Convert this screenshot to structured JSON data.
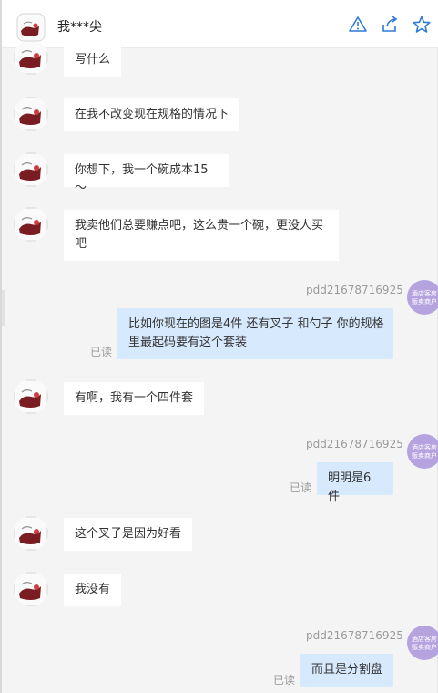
{
  "header": {
    "title": "我***尖",
    "icons": [
      "alert-icon",
      "share-icon",
      "star-icon"
    ],
    "accent_color": "#2f7bd6"
  },
  "messages": [
    {
      "side": "in",
      "text": "写什么"
    },
    {
      "side": "in",
      "text": "在我不改变现在规格的情况下"
    },
    {
      "side": "in",
      "text": "你想下，我一个碗成本15～"
    },
    {
      "side": "in",
      "text": "我卖他们总要赚点吧，这么贵一个碗，更没人买吧"
    },
    {
      "side": "out",
      "sender": "pdd21678716925",
      "text": "比如你现在的图是4件 还有叉子 和勺子 你的规格里最起码要有这个套装",
      "status": "已读"
    },
    {
      "side": "in",
      "text": "有啊，我有一个四件套"
    },
    {
      "side": "out",
      "sender": "pdd21678716925",
      "text": "明明是6件",
      "status": "已读"
    },
    {
      "side": "in",
      "text": "这个叉子是因为好看"
    },
    {
      "side": "in",
      "text": "我没有"
    },
    {
      "side": "out",
      "sender": "pdd21678716925",
      "text": "而且是分割盘",
      "status": "已读"
    }
  ],
  "my_avatar_text": "酒店客房\n贩卖商户",
  "colors": {
    "bubble_in": "#ffffff",
    "bubble_out": "#d7e9fc",
    "my_avatar": "#b5a3df",
    "background": "#f4f4f4"
  }
}
